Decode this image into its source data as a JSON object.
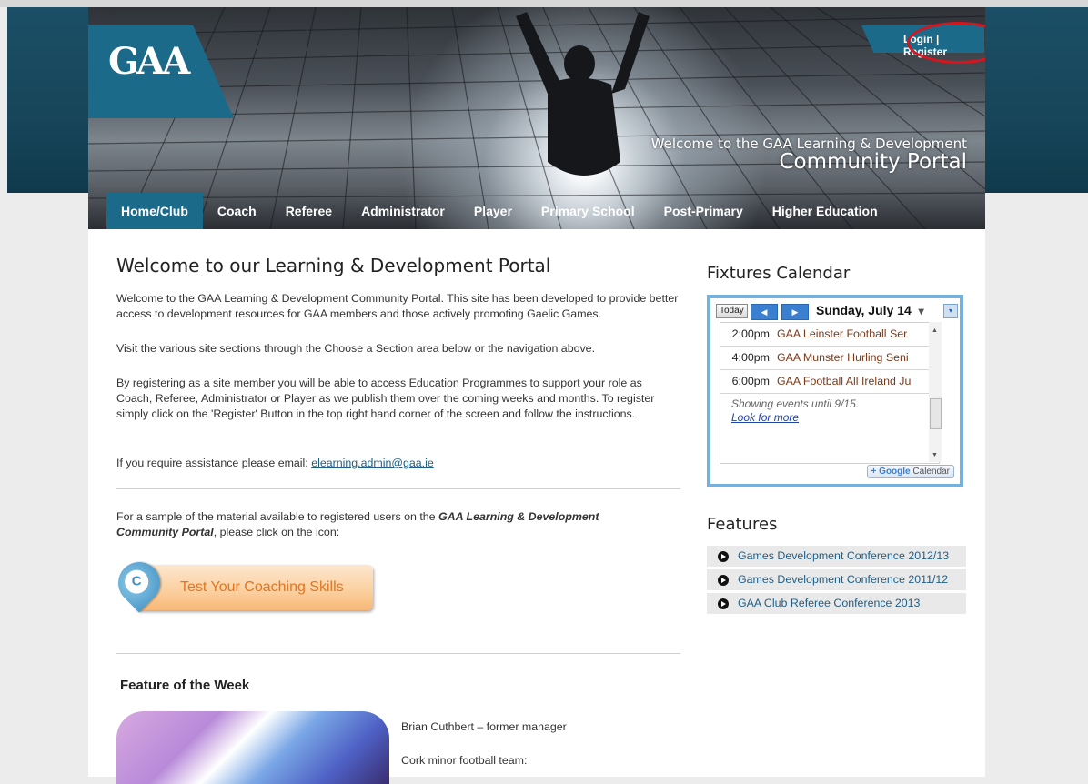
{
  "header": {
    "logo_text": "GAA",
    "login_label": "Login",
    "separator": "|",
    "register_label": "Register",
    "welcome_line1": "Welcome to the GAA Learning & Development",
    "welcome_line2": "Community Portal"
  },
  "nav": {
    "items": [
      {
        "label": "Home/Club",
        "active": true
      },
      {
        "label": "Coach"
      },
      {
        "label": "Referee"
      },
      {
        "label": "Administrator"
      },
      {
        "label": "Player"
      },
      {
        "label": "Primary School"
      },
      {
        "label": "Post-Primary"
      },
      {
        "label": "Higher Education"
      }
    ]
  },
  "main": {
    "title": "Welcome to our Learning & Development Portal",
    "para1": "Welcome to the GAA Learning & Development Community Portal. This site has been developed to provide better access to development resources for GAA members and those actively promoting Gaelic Games.",
    "para2": "Visit the various site sections through the Choose a Section area below or the navigation above.",
    "para3": "By registering as a site member you will be able to access Education Programmes to support your role as Coach, Referee, Administrator or Player as we publish them over the coming weeks and months. To register simply click on the 'Register' Button in the top right hand corner of the screen and follow the instructions.",
    "assist_text": "If you require assistance please email: ",
    "assist_email": "elearning.admin@gaa.ie",
    "sample_pre": "For a sample of the material available to registered users on the ",
    "sample_bold": "GAA Learning & Development Community Portal",
    "sample_post": ", please click on the icon:",
    "test_button_label": "Test Your Coaching Skills",
    "test_icon_letter": "C",
    "fotw_title": "Feature of the Week",
    "fotw_text1": "Brian Cuthbert – former manager",
    "fotw_text2": "Cork minor football team:"
  },
  "calendar": {
    "heading": "Fixtures Calendar",
    "today_label": "Today",
    "prev_icon": "◀",
    "next_icon": "▶",
    "date_label": "Sunday, July 14",
    "dropdown_icon": "▾",
    "events": [
      {
        "time": "2:00pm",
        "title": "GAA Leinster Football Ser"
      },
      {
        "time": "4:00pm",
        "title": "GAA Munster Hurling Seni"
      },
      {
        "time": "6:00pm",
        "title": "GAA Football All Ireland Ju"
      }
    ],
    "showing_text": "Showing events until 9/15.",
    "look_more": "Look for more",
    "google_label": "Google",
    "calendar_label": "Calendar"
  },
  "features": {
    "heading": "Features",
    "items": [
      "Games Development Conference 2012/13",
      "Games Development Conference 2011/12",
      "GAA Club Referee Conference 2013"
    ]
  }
}
